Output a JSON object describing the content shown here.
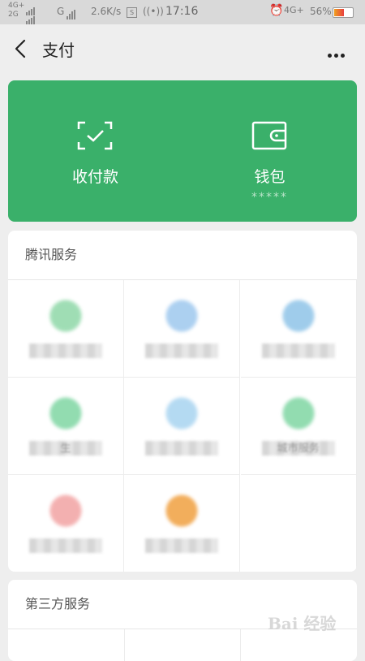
{
  "status_bar": {
    "network_top": "4G+",
    "network_bottom": "2G",
    "network2": "G",
    "speed": "2.6K/s",
    "clock": "17:16",
    "network3": "4G+",
    "battery": "56%",
    "battery_level": 0.56
  },
  "nav": {
    "title": "支付",
    "back_icon": "back-arrow-icon",
    "more_icon": "more-dots-icon"
  },
  "wallet_banner": {
    "color": "#3ab06a",
    "items": [
      {
        "label": "收付款",
        "icon": "qr-scan-check-icon"
      },
      {
        "label": "钱包",
        "sub": "*****",
        "icon": "wallet-icon"
      }
    ]
  },
  "tencent_services": {
    "header": "腾讯服务",
    "cells": [
      {
        "icon": "credit-card-icon",
        "label": "",
        "color": "#8fd8a8"
      },
      {
        "icon": "phone-recharge-icon",
        "label": "",
        "color": "#9ec8ee"
      },
      {
        "icon": "finance-icon",
        "label": "",
        "color": "#8fc4e8"
      },
      {
        "icon": "city-service-icon",
        "label": "生",
        "color": "#7fd6a3"
      },
      {
        "icon": "wechat-hongbao-icon",
        "label": "",
        "color": "#a8d4f0"
      },
      {
        "icon": "charity-icon",
        "label": "城市服务",
        "color": "#7fd6a3"
      },
      {
        "icon": "heart-icon",
        "label": "",
        "color": "#f2a3a3"
      },
      {
        "icon": "insurance-icon",
        "label": "",
        "color": "#f0a040"
      },
      {
        "icon": "",
        "label": "",
        "color": ""
      }
    ]
  },
  "third_party_services": {
    "header": "第三方服务"
  },
  "watermark": "Bai 经验"
}
